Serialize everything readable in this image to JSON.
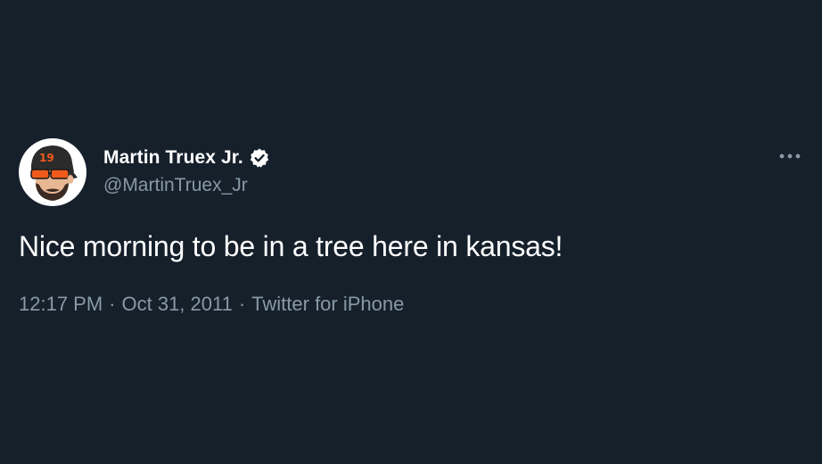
{
  "author": {
    "display_name": "Martin Truex Jr.",
    "handle": "@MartinTruex_Jr",
    "verified": true,
    "avatar_icon": "cartoon-avatar-icon",
    "avatar_cap_number": "19"
  },
  "tweet": {
    "text": "Nice morning to be in a tree here in kansas!",
    "time": "12:17 PM",
    "separator": "·",
    "date": "Oct 31, 2011",
    "source": "Twitter for iPhone"
  },
  "icons": {
    "verified": "verified-badge-icon",
    "more": "more-options-icon"
  },
  "colors": {
    "background": "#15202b",
    "primary_text": "#ffffff",
    "secondary_text": "#8899a6",
    "accent_orange": "#f05a1a"
  }
}
